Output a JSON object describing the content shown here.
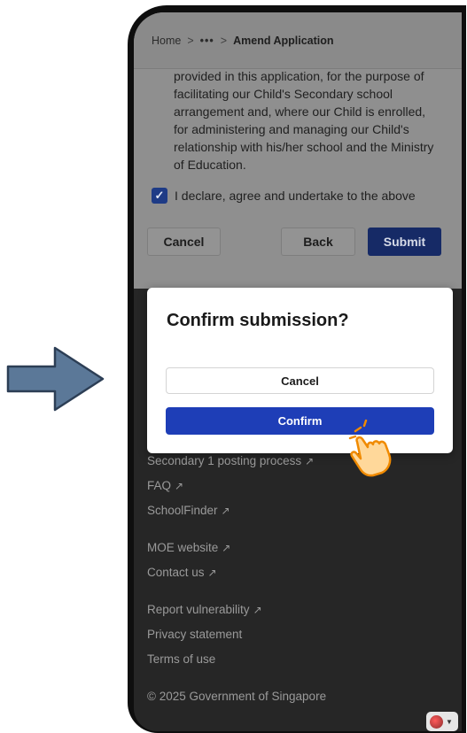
{
  "breadcrumb": {
    "home": "Home",
    "separator": ">",
    "ellipsis": "•••",
    "current": "Amend Application"
  },
  "legal_text": {
    "lines": [
      "provided in this application, for the purpose of",
      "facilitating our Child's Secondary school",
      "arrangement and, where our Child is enrolled,",
      "for administering and managing our Child's",
      "relationship with his/her school and the Ministry",
      "of Education."
    ]
  },
  "declaration": {
    "label": "I declare, agree and undertake to the above",
    "checked": true
  },
  "actions": {
    "cancel": "Cancel",
    "back": "Back",
    "submit": "Submit"
  },
  "modal": {
    "title": "Confirm submission?",
    "cancel": "Cancel",
    "confirm": "Confirm"
  },
  "footer": {
    "posting": "Secondary 1 posting process",
    "faq": "FAQ",
    "schoolfinder": "SchoolFinder",
    "moe": "MOE website",
    "contact": "Contact us",
    "report": "Report vulnerability",
    "privacy": "Privacy statement",
    "terms": "Terms of use",
    "copyright": "© 2025 Government of Singapore",
    "external_icon": "↗"
  },
  "colors": {
    "primary": "#1e3eb7",
    "arrow_fill": "#5b7898",
    "hand_fill": "#ffd89a",
    "hand_outline": "#f08a00"
  },
  "icons": {
    "pointer": "right-arrow-icon",
    "hand": "tap-hand-icon",
    "check": "checkmark-icon",
    "external": "external-link-icon"
  }
}
